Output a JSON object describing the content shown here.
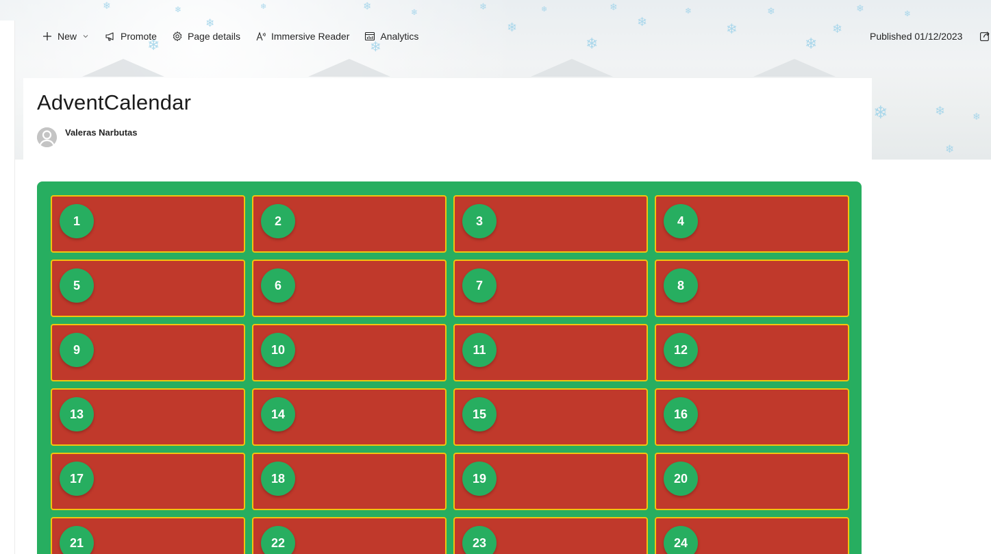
{
  "commandbar": {
    "new_label": "New",
    "promote_label": "Promote",
    "page_details_label": "Page details",
    "immersive_reader_label": "Immersive Reader",
    "analytics_label": "Analytics"
  },
  "published": "Published 01/12/2023",
  "page": {
    "title": "AdventCalendar",
    "author": "Valeras Narbutas"
  },
  "calendar": {
    "colors": {
      "background": "#27ae60",
      "door": "#c0392b",
      "border": "#f1c40f",
      "badge": "#27ae60"
    },
    "days": [
      "1",
      "2",
      "3",
      "4",
      "5",
      "6",
      "7",
      "8",
      "9",
      "10",
      "11",
      "12",
      "13",
      "14",
      "15",
      "16",
      "17",
      "18",
      "19",
      "20",
      "21",
      "22",
      "23",
      "24"
    ]
  },
  "icons": [
    "plus-icon",
    "chevron-down-icon",
    "megaphone-icon",
    "gear-icon",
    "immersive-reader-icon",
    "analytics-icon",
    "share-icon",
    "person-icon"
  ]
}
